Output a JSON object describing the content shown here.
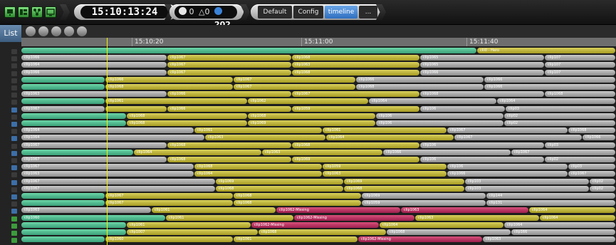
{
  "toolbar": {
    "icons": [
      "monitor-icon",
      "layout-icon",
      "network-icon",
      "display-icon"
    ],
    "clock": "15:10:13:24",
    "status": {
      "ok_count": "0",
      "warn_count": "0",
      "info_count": "202"
    },
    "tabs": [
      {
        "label": "Default",
        "active": false
      },
      {
        "label": "Config",
        "active": false
      },
      {
        "label": "timeline",
        "active": true
      },
      {
        "label": "...",
        "active": false
      }
    ]
  },
  "sidebar": {
    "list_label": "List"
  },
  "controls": [
    "rewind-icon",
    "play-icon",
    "home-icon",
    "add-icon",
    "remove-icon"
  ],
  "ruler": {
    "labels": [
      "15:10:20",
      "15:11:00",
      "15:11:40"
    ]
  },
  "colors": {
    "green": "#4fbf8d",
    "yellow": "#c8bf3a",
    "gray": "#aeaeae",
    "red": "#c7336a",
    "playhead": "#f2f200"
  },
  "timeline": {
    "rows": [
      [
        [
          "green",
          0,
          640,
          ""
        ],
        [
          "yellow",
          640,
          835,
          "clii0 - Hero"
        ]
      ],
      [
        [
          "gray",
          0,
          205,
          "clip1066"
        ],
        [
          "yellow",
          205,
          380,
          "clip1067"
        ],
        [
          "yellow",
          380,
          560,
          "clip1068"
        ],
        [
          "gray",
          560,
          735,
          "clip1065"
        ],
        [
          "gray",
          735,
          835,
          "clip107"
        ]
      ],
      [
        [
          "gray",
          0,
          205,
          "clip1064"
        ],
        [
          "yellow",
          205,
          380,
          "clip1067"
        ],
        [
          "yellow",
          380,
          560,
          "clip1063"
        ],
        [
          "gray",
          560,
          735,
          "clip1065"
        ],
        [
          "gray",
          735,
          835,
          "clip107"
        ]
      ],
      [
        [
          "gray",
          0,
          205,
          "clip1066"
        ],
        [
          "yellow",
          205,
          380,
          "clip1067"
        ],
        [
          "yellow",
          380,
          560,
          "clip1068"
        ],
        [
          "gray",
          560,
          735,
          "clip1066"
        ],
        [
          "gray",
          735,
          835,
          "clip107"
        ]
      ],
      [
        [
          "green",
          0,
          118,
          ""
        ],
        [
          "yellow",
          118,
          298,
          "clip1066"
        ],
        [
          "yellow",
          298,
          470,
          "clip1067"
        ],
        [
          "gray",
          470,
          650,
          "clip1066"
        ],
        [
          "gray",
          650,
          835,
          "clip1066"
        ]
      ],
      [
        [
          "green",
          0,
          118,
          ""
        ],
        [
          "yellow",
          118,
          298,
          "clip1068"
        ],
        [
          "yellow",
          298,
          470,
          "clip1067"
        ],
        [
          "gray",
          470,
          650,
          "clip1068"
        ],
        [
          "gray",
          650,
          835,
          "clip1066"
        ]
      ],
      [
        [
          "gray",
          0,
          205,
          "clip1063"
        ],
        [
          "yellow",
          205,
          380,
          "clip1066"
        ],
        [
          "yellow",
          380,
          560,
          "clip1067"
        ],
        [
          "gray",
          560,
          735,
          "clip1068"
        ],
        [
          "gray",
          735,
          835,
          "clip1068"
        ]
      ],
      [
        [
          "green",
          0,
          118,
          ""
        ],
        [
          "yellow",
          118,
          318,
          "clip1061"
        ],
        [
          "yellow",
          318,
          488,
          "clip1062"
        ],
        [
          "gray",
          488,
          668,
          "clip1064"
        ],
        [
          "gray",
          668,
          835,
          "clip1064"
        ]
      ],
      [
        [
          "gray",
          0,
          118,
          "clip1067"
        ],
        [
          "yellow",
          118,
          205,
          ""
        ],
        [
          "yellow",
          205,
          380,
          "clip1066"
        ],
        [
          "yellow",
          380,
          560,
          "clip1059"
        ],
        [
          "gray",
          560,
          680,
          "clip106"
        ],
        [
          "gray",
          680,
          835,
          "clip03"
        ]
      ],
      [
        [
          "green",
          0,
          148,
          ""
        ],
        [
          "yellow",
          148,
          318,
          "clip1068"
        ],
        [
          "yellow",
          318,
          498,
          "clip1068"
        ],
        [
          "gray",
          498,
          678,
          "clip106"
        ],
        [
          "gray",
          678,
          835,
          "clip02"
        ]
      ],
      [
        [
          "green",
          0,
          148,
          ""
        ],
        [
          "yellow",
          148,
          318,
          "clip1068"
        ],
        [
          "yellow",
          318,
          498,
          "clip1069"
        ],
        [
          "gray",
          498,
          678,
          "clip106"
        ],
        [
          "gray",
          678,
          835,
          "clip02"
        ]
      ],
      [
        [
          "gray",
          0,
          243,
          "clip1064"
        ],
        [
          "yellow",
          243,
          423,
          "clip1061"
        ],
        [
          "yellow",
          423,
          598,
          "clip1061"
        ],
        [
          "gray",
          598,
          768,
          "clip1067"
        ],
        [
          "gray",
          768,
          835,
          "clip1068"
        ]
      ],
      [
        [
          "gray",
          0,
          258,
          "clip1064"
        ],
        [
          "yellow",
          258,
          428,
          "clip1063"
        ],
        [
          "yellow",
          428,
          608,
          "clip1064"
        ],
        [
          "gray",
          608,
          788,
          "clip1067"
        ],
        [
          "gray",
          788,
          835,
          "clip1066"
        ]
      ],
      [
        [
          "gray",
          0,
          205,
          "clip1067"
        ],
        [
          "yellow",
          205,
          380,
          "clip1068"
        ],
        [
          "yellow",
          380,
          560,
          "clip1068"
        ],
        [
          "gray",
          560,
          735,
          "clip106"
        ],
        [
          "gray",
          735,
          835,
          "clip03"
        ]
      ],
      [
        [
          "green",
          0,
          158,
          ""
        ],
        [
          "yellow",
          158,
          338,
          "clip1064"
        ],
        [
          "yellow",
          338,
          508,
          "clip1063"
        ],
        [
          "gray",
          508,
          688,
          "clip1066"
        ],
        [
          "gray",
          688,
          835,
          "clip1067"
        ]
      ],
      [
        [
          "gray",
          0,
          205,
          "clip1067"
        ],
        [
          "yellow",
          205,
          380,
          "clip1068"
        ],
        [
          "yellow",
          380,
          560,
          "clip1069"
        ],
        [
          "gray",
          560,
          735,
          "clip106"
        ],
        [
          "gray",
          735,
          835,
          "clip02"
        ]
      ],
      [
        [
          "gray",
          0,
          243,
          "clip1067"
        ],
        [
          "yellow",
          243,
          423,
          "clip1068"
        ],
        [
          "yellow",
          423,
          598,
          "clip1059"
        ],
        [
          "gray",
          598,
          768,
          "clip106"
        ],
        [
          "gray",
          768,
          835,
          "clip03"
        ]
      ],
      [
        [
          "gray",
          0,
          243,
          "clip1063"
        ],
        [
          "yellow",
          243,
          423,
          "clip1064"
        ],
        [
          "yellow",
          423,
          598,
          "clip1063"
        ],
        [
          "gray",
          598,
          768,
          "clip1066"
        ],
        [
          "gray",
          768,
          835,
          "clip1067"
        ]
      ],
      [
        [
          "gray",
          0,
          273,
          "clip1067"
        ],
        [
          "yellow",
          273,
          453,
          "clip1069"
        ],
        [
          "yellow",
          453,
          623,
          "clip1069"
        ],
        [
          "gray",
          623,
          798,
          "clip103"
        ],
        [
          "gray",
          798,
          835,
          "clip02"
        ]
      ],
      [
        [
          "gray",
          0,
          273,
          "clip1067"
        ],
        [
          "yellow",
          273,
          453,
          "clip1068"
        ],
        [
          "yellow",
          453,
          623,
          "clip1068"
        ],
        [
          "gray",
          623,
          798,
          "clip103"
        ],
        [
          "gray",
          798,
          835,
          "clip02"
        ]
      ],
      [
        [
          "green",
          0,
          118,
          ""
        ],
        [
          "yellow",
          118,
          298,
          "clip1067"
        ],
        [
          "yellow",
          298,
          478,
          "clip1068"
        ],
        [
          "gray",
          478,
          653,
          "clip1069"
        ],
        [
          "gray",
          653,
          835,
          "clip144"
        ]
      ],
      [
        [
          "green",
          0,
          118,
          ""
        ],
        [
          "yellow",
          118,
          298,
          "clip1067"
        ],
        [
          "yellow",
          298,
          478,
          "clip1068"
        ],
        [
          "gray",
          478,
          653,
          "clip1059"
        ],
        [
          "gray",
          653,
          835,
          "clip131"
        ]
      ],
      [
        [
          "gray",
          0,
          183,
          "clip1063"
        ],
        [
          "yellow",
          183,
          358,
          "clip1061"
        ],
        [
          "red",
          358,
          533,
          "clip1062-Missing"
        ],
        [
          "red",
          533,
          713,
          "clip1063"
        ],
        [
          "yellow",
          713,
          835,
          "clip1064"
        ]
      ],
      [
        [
          "green",
          0,
          203,
          "clip1060"
        ],
        [
          "yellow",
          203,
          383,
          "clip1061"
        ],
        [
          "red",
          383,
          553,
          "clip1062-Missing"
        ],
        [
          "yellow",
          553,
          728,
          "clip1063"
        ],
        [
          "yellow",
          728,
          835,
          "clip1064"
        ]
      ],
      [
        [
          "green",
          0,
          148,
          ""
        ],
        [
          "yellow",
          148,
          323,
          "clip1061"
        ],
        [
          "red",
          323,
          503,
          "clip1062-Missing"
        ],
        [
          "yellow",
          503,
          678,
          "clip1064"
        ],
        [
          "gray",
          678,
          835,
          "clip1064"
        ]
      ],
      [
        [
          "green",
          0,
          148,
          ""
        ],
        [
          "yellow",
          148,
          333,
          "clip1007"
        ],
        [
          "yellow",
          333,
          513,
          "clip1068"
        ],
        [
          "gray",
          513,
          688,
          "clip1068"
        ],
        [
          "gray",
          688,
          835,
          "clip166"
        ]
      ],
      [
        [
          "green",
          0,
          118,
          ""
        ],
        [
          "yellow",
          118,
          298,
          "clip1060"
        ],
        [
          "yellow",
          298,
          473,
          "clip1061"
        ],
        [
          "red",
          473,
          648,
          "clip1062-Missing"
        ],
        [
          "gray",
          648,
          835,
          "clip1063"
        ]
      ]
    ]
  }
}
